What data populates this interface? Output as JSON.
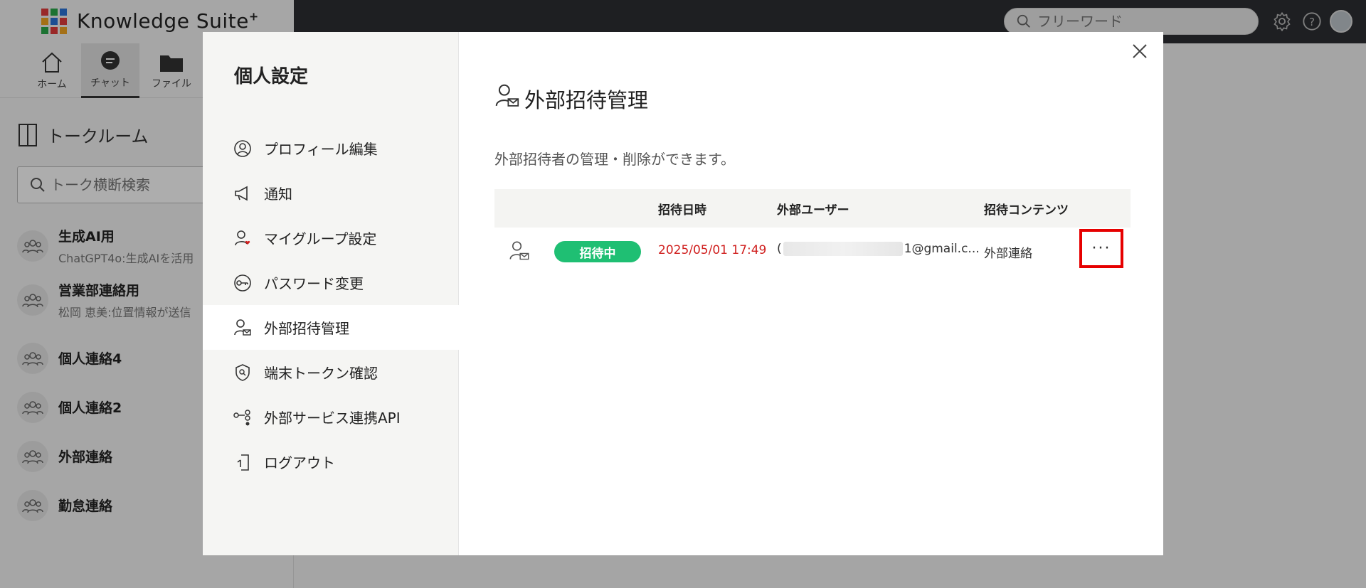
{
  "app": {
    "brand": "Knowledge Suite",
    "brand_sup": "+",
    "search_placeholder": "フリーワード"
  },
  "nav": [
    {
      "label": "ホーム"
    },
    {
      "label": "チャット"
    },
    {
      "label": "ファイル"
    }
  ],
  "talk": {
    "title": "トークルーム",
    "search_placeholder": "トーク横断検索",
    "rooms": [
      {
        "name": "生成AI用",
        "sub": "ChatGPT4o:生成AIを活用"
      },
      {
        "name": "営業部連絡用",
        "sub": "松岡 恵美:位置情報が送信"
      },
      {
        "name": "個人連絡4",
        "sub": ""
      },
      {
        "name": "個人連絡2",
        "sub": ""
      },
      {
        "name": "外部連絡",
        "sub": ""
      },
      {
        "name": "勤怠連絡",
        "sub": ""
      }
    ]
  },
  "modal": {
    "side_title": "個人設定",
    "menu": [
      {
        "label": "プロフィール編集",
        "icon": "profile-icon"
      },
      {
        "label": "通知",
        "icon": "megaphone-icon"
      },
      {
        "label": "マイグループ設定",
        "icon": "my-group-icon"
      },
      {
        "label": "パスワード変更",
        "icon": "key-icon"
      },
      {
        "label": "外部招待管理",
        "icon": "external-invite-icon"
      },
      {
        "label": "端末トークン確認",
        "icon": "shield-icon"
      },
      {
        "label": "外部サービス連携API",
        "icon": "api-icon"
      },
      {
        "label": "ログアウト",
        "icon": "logout-icon"
      }
    ],
    "active_index": 4,
    "main_title": "外部招待管理",
    "description": "外部招待者の管理・削除ができます。",
    "table": {
      "headers": [
        "招待日時",
        "外部ユーザー",
        "招待コンテンツ"
      ],
      "rows": [
        {
          "status": "招待中",
          "date": "2025/05/01 17:49",
          "email_prefix": "(",
          "email_suffix": "1@gmail.c...",
          "content": "外部連絡",
          "more": "···"
        }
      ]
    }
  },
  "colors": {
    "status_green": "#1fbf73",
    "date_red": "#d0201f",
    "highlight_red": "#e60000",
    "topbar": "#2d2f33"
  }
}
